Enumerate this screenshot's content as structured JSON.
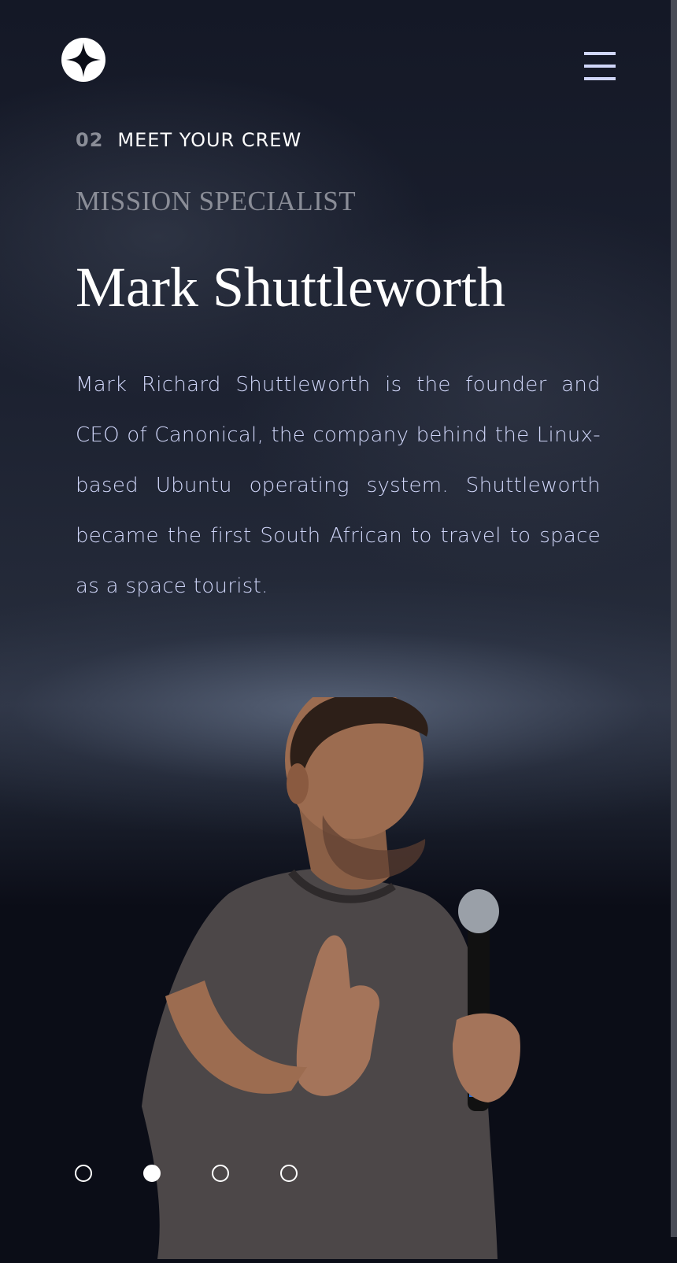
{
  "header": {
    "logo": "star-logo-icon",
    "menu_icon": "hamburger-menu-icon"
  },
  "eyebrow": {
    "number": "02",
    "title": "MEET YOUR CREW"
  },
  "crew": {
    "role": "MISSION SPECIALIST",
    "name": "Mark Shuttleworth",
    "bio": "Mark Richard Shuttleworth is the founder and CEO of Canonical, the company behind the Linux-based Ubuntu operating system. Shuttleworth became the first South African to travel to space as a space tourist."
  },
  "pagination": {
    "count": 4,
    "active_index": 1
  },
  "colors": {
    "background": "#0b0d17",
    "accent_light": "#d0d6f9",
    "muted": "#8a8d97",
    "white": "#ffffff"
  }
}
